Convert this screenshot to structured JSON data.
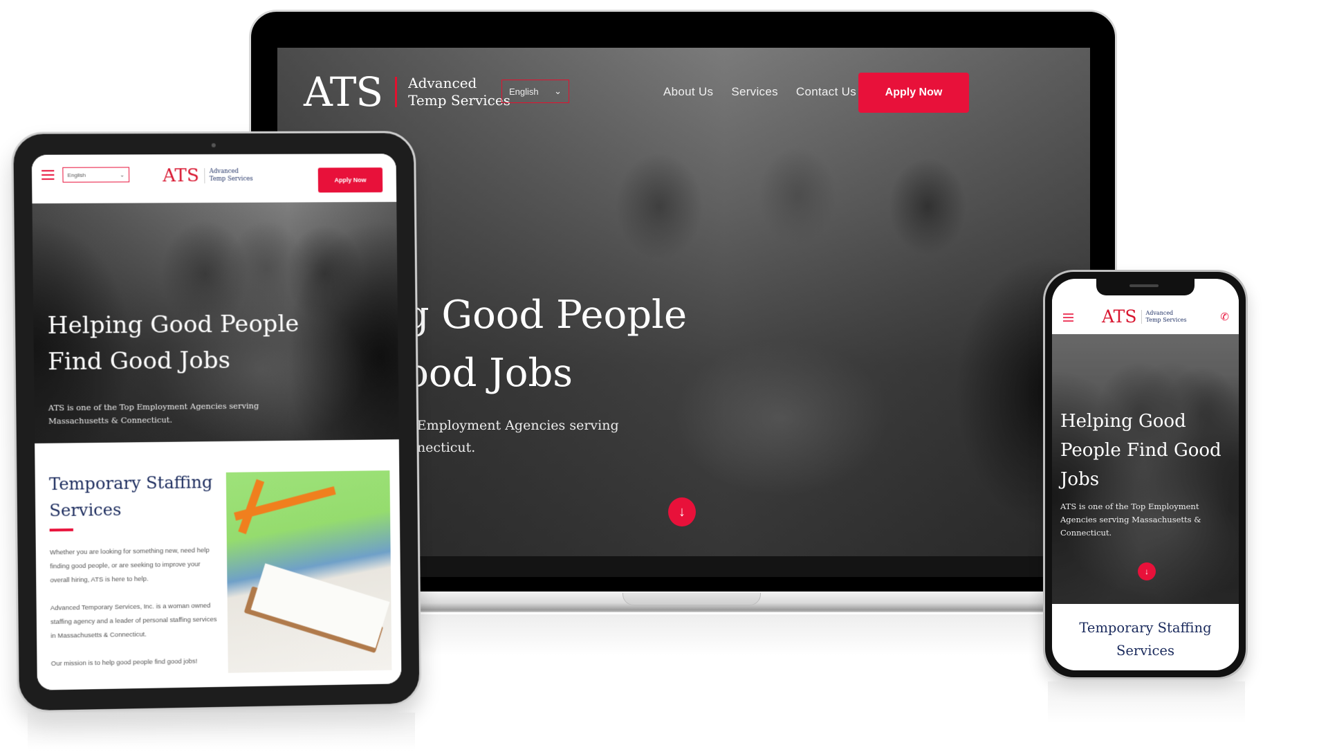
{
  "brand": {
    "mark": "ATS",
    "name_line1": "Advanced",
    "name_line2": "Temp Services",
    "accent_color": "#e8113a",
    "navy_color": "#1a2a5c"
  },
  "laptop": {
    "language_select": {
      "value": "English",
      "icon": "chevron-down-icon"
    },
    "nav": [
      {
        "label": "About Us"
      },
      {
        "label": "Services"
      },
      {
        "label": "Contact Us"
      }
    ],
    "apply_label": "Apply Now",
    "hero": {
      "title_line1": "Helping Good People",
      "title_line2": "Find Good Jobs",
      "subtitle_line1": "ATS is one of the Top Employment Agencies serving",
      "subtitle_line2": "Massachusetts & Connecticut.",
      "scroll_icon": "arrow-down-icon"
    }
  },
  "tablet": {
    "menu_icon": "hamburger-icon",
    "language_select": {
      "value": "English"
    },
    "apply_label": "Apply Now",
    "hero": {
      "title_line1": "Helping Good People",
      "title_line2": "Find Good Jobs",
      "subtitle_line1": "ATS is one of the Top Employment Agencies serving",
      "subtitle_line2": "Massachusetts & Connecticut."
    },
    "section": {
      "title_line1": "Temporary Staffing",
      "title_line2": "Services",
      "paragraphs": [
        "Whether you are looking for something new, need help finding good people, or are seeking to improve your overall hiring, ATS is here to help.",
        "Advanced Temporary Services, Inc. is a woman owned staffing agency and a leader of personal staffing services in Massachusetts & Connecticut.",
        "Our mission is to help good people find good jobs!"
      ]
    }
  },
  "phone": {
    "menu_icon": "hamburger-icon",
    "call_icon": "phone-icon",
    "hero": {
      "title_line1": "Helping Good",
      "title_line2": "People Find Good",
      "title_line3": "Jobs",
      "subtitle": "ATS is one of the Top Employment Agencies serving Massachusetts & Connecticut."
    },
    "section": {
      "title_line1": "Temporary Staffing",
      "title_line2": "Services"
    }
  }
}
